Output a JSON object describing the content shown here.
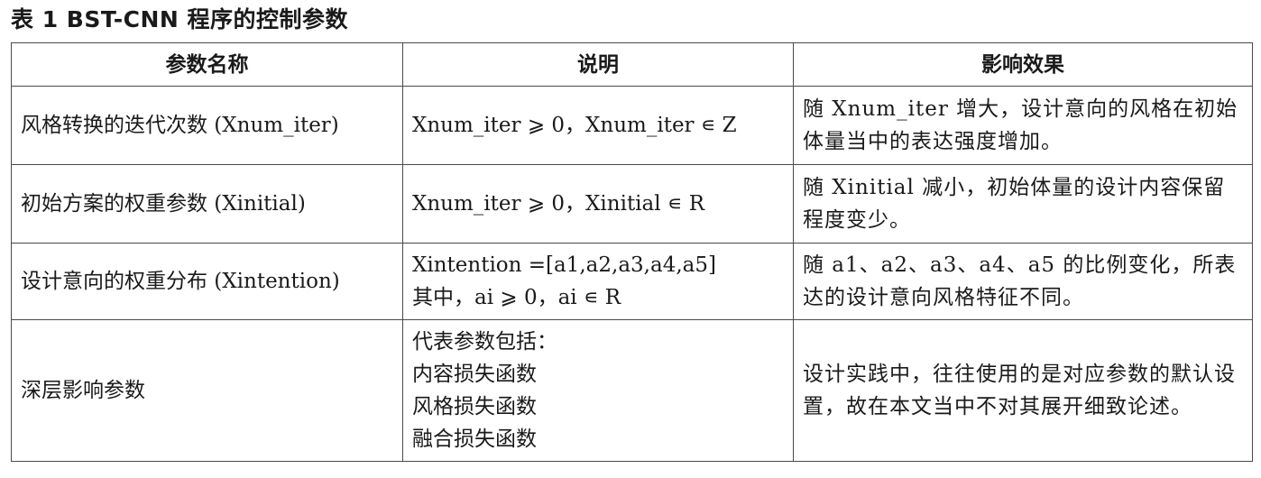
{
  "title": "表 1 BST-CNN 程序的控制参数",
  "headers": [
    "参数名称",
    "说明",
    "影响效果"
  ],
  "rows": [
    {
      "name": "风格转换的迭代次数 (Xnum_iter)",
      "description": [
        "Xnum_iter ⩾ 0，Xnum_iter ∊ Z"
      ],
      "effect": "随 Xnum_iter 增大，设计意向的风格在初始体量当中的表达强度增加。"
    },
    {
      "name": "初始方案的权重参数 (Xinitial)",
      "description": [
        "Xnum_iter ⩾ 0，Xinitial ∊ R"
      ],
      "effect": "随 Xinitial 减小，初始体量的设计内容保留程度变少。"
    },
    {
      "name": "设计意向的权重分布 (Xintention)",
      "description": [
        "Xintention =[a1,a2,a3,a4,a5]",
        "其中，ai ⩾ 0，ai ∊ R"
      ],
      "effect": "随 a1、a2、a3、a4、a5 的比例变化，所表达的设计意向风格特征不同。"
    },
    {
      "name": "深层影响参数",
      "description": [
        "代表参数包括：",
        "内容损失函数",
        "风格损失函数",
        "融合损失函数"
      ],
      "effect": "设计实践中，往往使用的是对应参数的默认设置，故在本文当中不对其展开细致论述。"
    }
  ]
}
